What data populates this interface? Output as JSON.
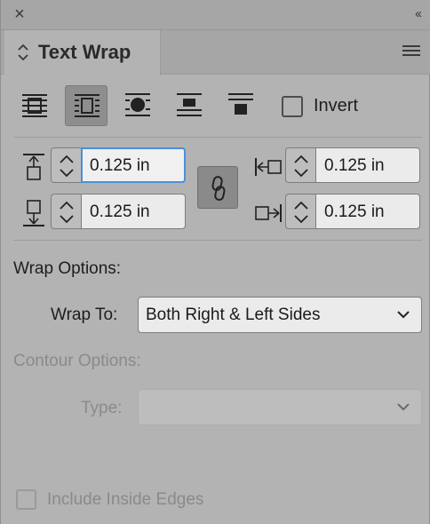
{
  "panel": {
    "title": "Text Wrap",
    "close_icon": "close-icon",
    "collapse_icon": "collapse-panel-icon",
    "menu_icon": "panel-menu-icon"
  },
  "wrap_types": [
    {
      "name": "no-text-wrap",
      "selected": false
    },
    {
      "name": "wrap-around-bounding-box",
      "selected": true
    },
    {
      "name": "wrap-around-object-shape",
      "selected": false
    },
    {
      "name": "jump-object",
      "selected": false
    },
    {
      "name": "jump-to-next-column",
      "selected": false
    }
  ],
  "invert": {
    "label": "Invert",
    "checked": false
  },
  "offsets": {
    "top": "0.125 in",
    "bottom": "0.125 in",
    "left": "0.125 in",
    "right": "0.125 in",
    "link_icon": "chain-link-icon",
    "linked": true
  },
  "wrap_options": {
    "heading": "Wrap Options:",
    "wrap_to_label": "Wrap To:",
    "wrap_to_value": "Both Right & Left Sides"
  },
  "contour_options": {
    "heading": "Contour Options:",
    "type_label": "Type:",
    "type_value": "",
    "enabled": false
  },
  "include_inside_edges": {
    "label": "Include Inside Edges",
    "checked": false,
    "enabled": false
  },
  "colors": {
    "panel_bg": "#b3b3b3",
    "focus": "#4a90d9",
    "field_bg": "#ebebeb",
    "selected_button": "#8e8e8e"
  }
}
